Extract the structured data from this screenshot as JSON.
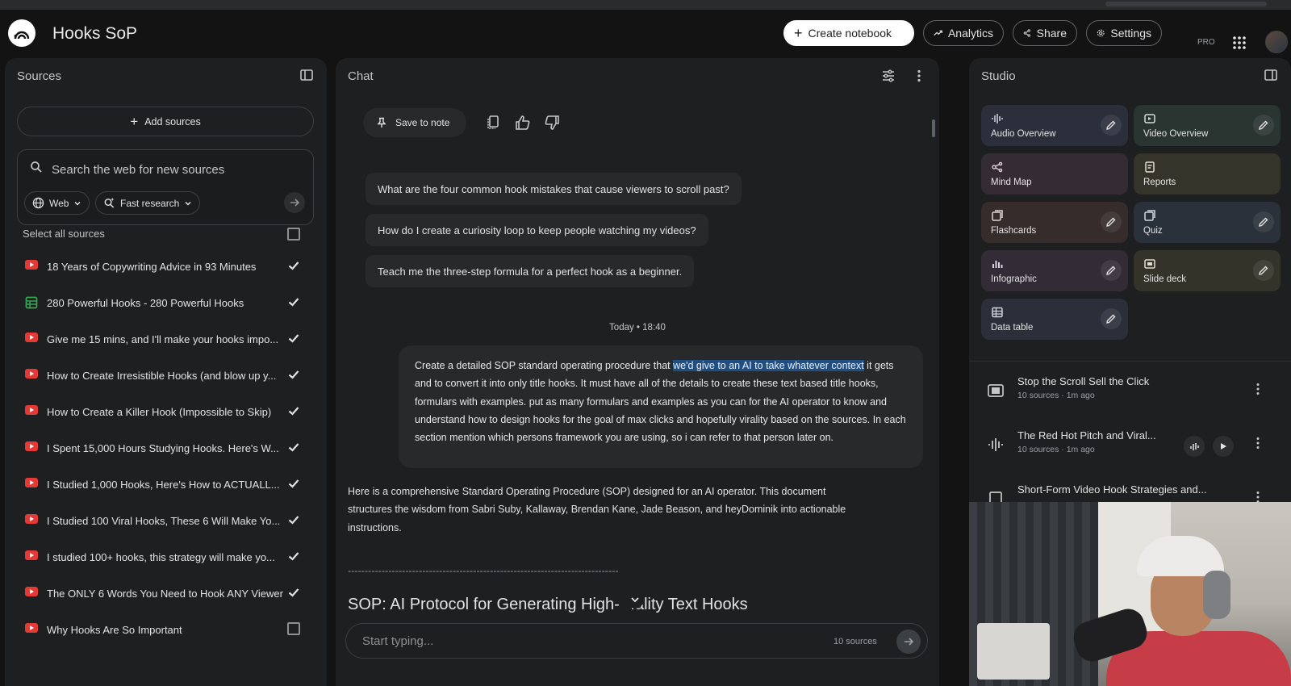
{
  "header": {
    "title": "Hooks SoP",
    "create_notebook": "Create notebook",
    "analytics": "Analytics",
    "share": "Share",
    "settings": "Settings",
    "pro_badge": "PRO"
  },
  "sources": {
    "title": "Sources",
    "add_sources": "Add sources",
    "search_placeholder": "Search the web for new sources",
    "web_chip": "Web",
    "research_chip": "Fast research",
    "select_all": "Select all sources",
    "items": [
      {
        "label": "18 Years of Copywriting Advice in 93 Minutes",
        "type": "youtube",
        "checked": true
      },
      {
        "label": "280 Powerful Hooks - 280 Powerful Hooks",
        "type": "sheet",
        "checked": true
      },
      {
        "label": "Give me 15 mins, and I'll make your hooks impo...",
        "type": "youtube",
        "checked": true
      },
      {
        "label": "How to Create Irresistible Hooks (and blow up y...",
        "type": "youtube",
        "checked": true
      },
      {
        "label": "How to Create a Killer Hook (Impossible to Skip)",
        "type": "youtube",
        "checked": true
      },
      {
        "label": "I Spent 15,000 Hours Studying Hooks. Here's W...",
        "type": "youtube",
        "checked": true
      },
      {
        "label": "I Studied 1,000 Hooks, Here's How to ACTUALL...",
        "type": "youtube",
        "checked": true
      },
      {
        "label": "I Studied 100 Viral Hooks, These 6 Will Make Yo...",
        "type": "youtube",
        "checked": true
      },
      {
        "label": "I studied 100+ hooks, this strategy will make yo...",
        "type": "youtube",
        "checked": true
      },
      {
        "label": "The ONLY 6 Words You Need to Hook ANY Viewer",
        "type": "youtube",
        "checked": true
      },
      {
        "label": "Why Hooks Are So Important",
        "type": "youtube",
        "checked": false
      }
    ]
  },
  "chat": {
    "title": "Chat",
    "save_to_note": "Save to note",
    "suggestions": [
      "What are the four common hook mistakes that cause viewers to scroll past?",
      "How do I create a curiosity loop to keep people watching my videos?",
      "Teach me the three-step formula for a perfect hook as a beginner."
    ],
    "timestamp": "Today • 18:40",
    "user_message": {
      "before": "Create a detailed SOP standard operating procedure that ",
      "highlighted": "we'd give to an AI to take whatever context",
      "after": " it gets and to convert it into only title hooks. It must have all of the details to create these text based title hooks, formulars with examples. put as many formulars and examples as you can for the AI operator to know and understand how to design hooks for the goal of max clicks and hopefully virality based on the sources. In each section mention which persons framework you are using, so i can refer to that person later on."
    },
    "ai_message": "Here is a comprehensive Standard Operating Procedure (SOP) designed for an AI operator. This document structures the wisdom from Sabri Suby, Kallaway, Brendan Kane, Jade Beason, and heyDominik into actionable instructions.",
    "divider": "--------------------------------------------------------------------------------",
    "heading": "SOP: AI Protocol for Generating High-   .ality Text Hooks",
    "input_placeholder": "Start typing...",
    "source_count": "10 sources"
  },
  "studio": {
    "title": "Studio",
    "tiles": [
      {
        "label": "Audio Overview",
        "icon": "audio-wave-icon",
        "color": "#2b2e3b",
        "edit": true
      },
      {
        "label": "Video Overview",
        "icon": "video-icon",
        "color": "#2a3431",
        "edit": true
      },
      {
        "label": "Mind Map",
        "icon": "mind-map-icon",
        "color": "#352b33",
        "edit": false
      },
      {
        "label": "Reports",
        "icon": "reports-icon",
        "color": "#35342a",
        "edit": false
      },
      {
        "label": "Flashcards",
        "icon": "flashcards-icon",
        "color": "#352c2b",
        "edit": true
      },
      {
        "label": "Quiz",
        "icon": "quiz-icon",
        "color": "#2a313a",
        "edit": true
      },
      {
        "label": "Infographic",
        "icon": "infographic-icon",
        "color": "#332b36",
        "edit": true
      },
      {
        "label": "Slide deck",
        "icon": "slide-deck-icon",
        "color": "#33332a",
        "edit": true
      },
      {
        "label": "Data table",
        "icon": "data-table-icon",
        "color": "#2b2f3a",
        "edit": true
      }
    ],
    "artifacts": [
      {
        "title": "Stop the Scroll Sell the Click",
        "meta": "10 sources · 1m ago",
        "icon": "slides-icon"
      },
      {
        "title": "The Red Hot Pitch and Viral...",
        "meta": "10 sources · 1m ago",
        "icon": "audio-wave-icon"
      },
      {
        "title": "Short-Form Video Hook Strategies and...",
        "meta": "",
        "icon": "report-icon"
      }
    ]
  }
}
